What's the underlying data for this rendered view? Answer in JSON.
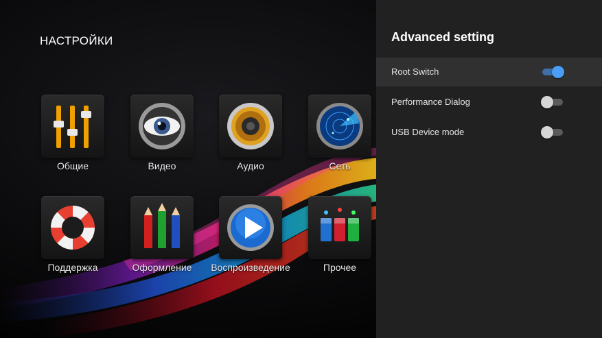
{
  "screen_title": "НАСТРОЙКИ",
  "tiles": [
    {
      "label": "Общие",
      "icon": "equalizer-sliders-icon"
    },
    {
      "label": "Видео",
      "icon": "eye-lens-icon"
    },
    {
      "label": "Аудио",
      "icon": "speaker-icon"
    },
    {
      "label": "Сеть",
      "icon": "radar-icon"
    },
    {
      "label": "Поддержка",
      "icon": "lifebuoy-icon"
    },
    {
      "label": "Оформление",
      "icon": "pencils-icon"
    },
    {
      "label": "Воспроизведение",
      "icon": "play-button-icon"
    },
    {
      "label": "Прочее",
      "icon": "indicator-lights-icon"
    }
  ],
  "panel": {
    "title": "Advanced setting",
    "items": [
      {
        "label": "Root Switch",
        "on": true
      },
      {
        "label": "Performance Dialog",
        "on": false
      },
      {
        "label": "USB Device mode",
        "on": false
      }
    ]
  },
  "colors": {
    "panel_bg": "#212121",
    "selected_row": "#303030",
    "switch_on": "#4a9cf5",
    "switch_off": "#d6d6d6"
  }
}
